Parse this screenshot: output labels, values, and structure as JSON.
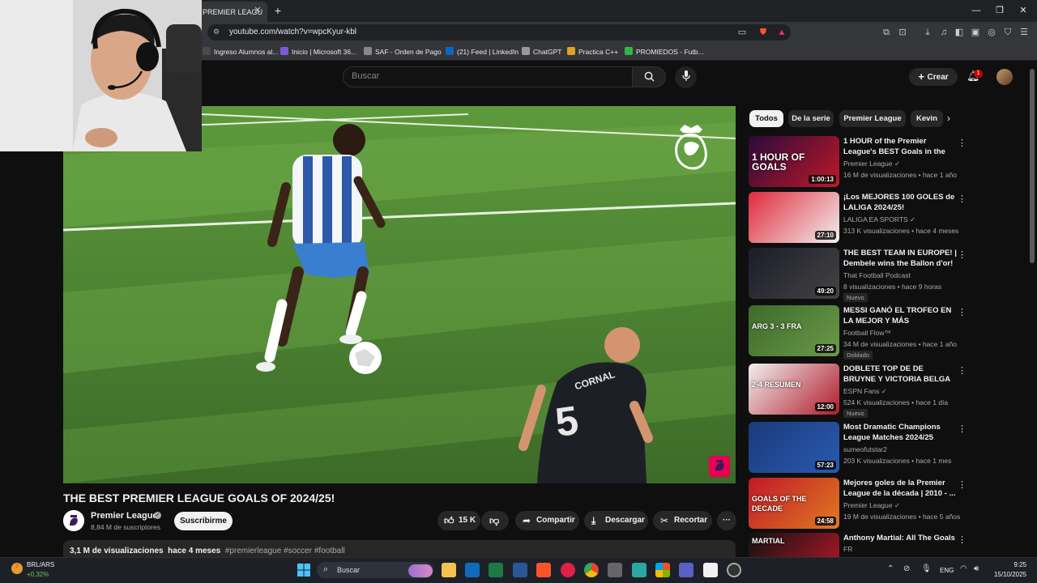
{
  "browser": {
    "tab_title": "PREMIER LEAGU",
    "tab_close": "✕",
    "new_tab": "+",
    "url": "youtube.com/watch?v=wpcKyur-kbl",
    "window_controls": [
      "—",
      "❐",
      "✕"
    ],
    "bookmarks": [
      {
        "label": "Ingreso Alumnos al...",
        "color": "#4a4a4a"
      },
      {
        "label": "Inicio | Microsoft 36...",
        "color": "#7b5cd6"
      },
      {
        "label": "SAF - Orden de Pago",
        "color": "#888888"
      },
      {
        "label": "(21) Feed | LinkedIn",
        "color": "#0a66c2"
      },
      {
        "label": "ChatGPT",
        "color": "#9a9a9a"
      },
      {
        "label": "Practica C++",
        "color": "#e0a020"
      },
      {
        "label": "PROMIEDOS - Futb...",
        "color": "#36b24a"
      }
    ]
  },
  "header": {
    "search_placeholder": "Buscar",
    "create_label": "Crear",
    "notification_count": "1"
  },
  "video": {
    "title": "THE BEST PREMIER LEAGUE GOALS OF 2024/25!",
    "channel": "Premier League",
    "subscribers": "8,84 M de suscriptores",
    "subscribe_label": "Suscribirme",
    "likes": "15 K",
    "share_label": "Compartir",
    "download_label": "Descargar",
    "clip_label": "Recortar",
    "more_label": "···",
    "views": "3,1 M de visualizaciones",
    "age": "hace 4 meses",
    "tags": "#premierleague #soccer #football",
    "player_number": "5",
    "player_name": "CORNAL"
  },
  "chips": [
    {
      "label": "Todos",
      "active": true
    },
    {
      "label": "De la serie",
      "active": false
    },
    {
      "label": "Premier League",
      "active": false
    },
    {
      "label": "Kevin",
      "active": false
    }
  ],
  "recommendations": [
    {
      "title": "1 HOUR of the Premier League's BEST Goals in the Last 10 ...",
      "channel": "Premier League",
      "verified": true,
      "meta": "16 M de visualizaciones • hace 1 año",
      "duration": "1:00:13",
      "badge": "",
      "thumb_text": "1 HOUR OF GOALS",
      "colors": [
        "#2a0a3a",
        "#c0182a"
      ]
    },
    {
      "title": "¡Los MEJORES 100 GOLES de LALIGA 2024/25!",
      "channel": "LALIGA EA SPORTS",
      "verified": true,
      "meta": "313 K visualizaciones • hace 4 meses",
      "duration": "27:10",
      "badge": "",
      "thumb_text": "",
      "colors": [
        "#e02a3a",
        "#f0f0f0"
      ]
    },
    {
      "title": "THE BEST TEAM IN EUROPE! | Dembele wins the Ballon d'or! |...",
      "channel": "That Football Podcast",
      "verified": false,
      "meta": "8 visualizaciones • hace 9 horas",
      "duration": "49:20",
      "badge": "Nuevo",
      "thumb_text": "",
      "colors": [
        "#1c1c2a",
        "#444"
      ]
    },
    {
      "title": "MESSI GANÓ EL TROFEO EN LA MEJOR Y MÁS DRAMÁTICA ...",
      "channel": "Football Flow™",
      "verified": false,
      "meta": "34 M de visualizaciones • hace 1 año",
      "duration": "27:25",
      "badge": "Doblado",
      "thumb_text": "ARG 3 - 3 FRA",
      "colors": [
        "#3d6a2a",
        "#6a9a4a"
      ]
    },
    {
      "title": "DOBLETE TOP DE DE BRUYNE Y VICTORIA BELGA EN UN ...",
      "channel": "ESPN Fans",
      "verified": true,
      "meta": "524 K visualizaciones • hace 1 día",
      "duration": "12:00",
      "badge": "Nuevo",
      "thumb_text": "2-4 RESUMEN",
      "colors": [
        "#f0f0f0",
        "#b01a2a"
      ]
    },
    {
      "title": "Most Dramatic Champions League Matches 2024/25",
      "channel": "sumeofutstar2",
      "verified": false,
      "meta": "203 K visualizaciones • hace 1 mes",
      "duration": "57:23",
      "badge": "",
      "thumb_text": "",
      "colors": [
        "#1a3a7a",
        "#2a5ab0"
      ]
    },
    {
      "title": "Mejores goles de la Premier League de la década | 2010 - ...",
      "channel": "Premier League",
      "verified": true,
      "meta": "19 M de visualizaciones • hace 5 años",
      "duration": "24:58",
      "badge": "",
      "thumb_text": "GOALS OF THE DECADE",
      "colors": [
        "#c0182a",
        "#e07a20"
      ]
    },
    {
      "title": "Anthony Martial: All The Goals",
      "channel": "FR",
      "verified": false,
      "meta": "",
      "duration": "",
      "badge": "",
      "thumb_text": "MARTIAL",
      "colors": [
        "#111",
        "#c0182a"
      ]
    }
  ],
  "taskbar": {
    "ticker": "BRL/ARS",
    "change": "+0,32%",
    "search_label": "Buscar",
    "lang": "ENG",
    "time": "9:25",
    "date": "15/10/2025"
  }
}
